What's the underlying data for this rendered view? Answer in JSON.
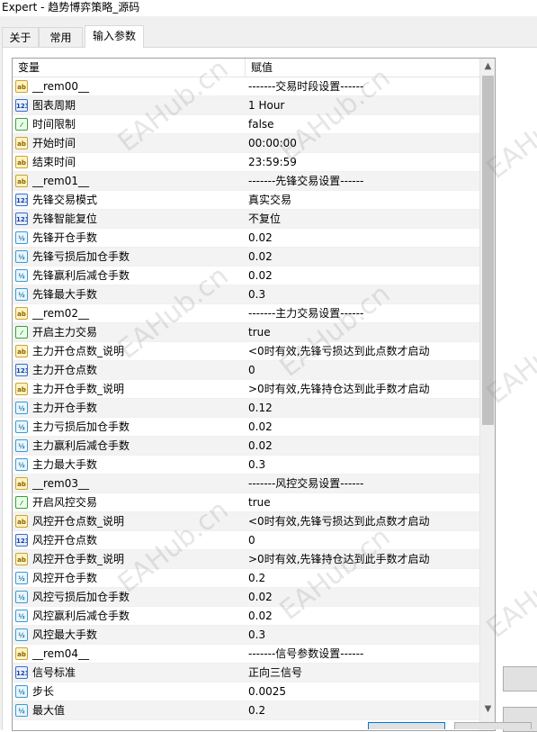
{
  "window": {
    "title": "Expert - 趋势博弈策略_源码"
  },
  "tabs": [
    {
      "label": "关于"
    },
    {
      "label": "常用"
    },
    {
      "label": "输入参数"
    }
  ],
  "grid": {
    "headers": {
      "variable": "变量",
      "value": "赋值"
    },
    "rows": [
      {
        "icon": "ab",
        "name": "__rem00__",
        "value": "-------交易时段设置------"
      },
      {
        "icon": "123",
        "name": "图表周期",
        "value": "1 Hour"
      },
      {
        "icon": "bool",
        "name": "时间限制",
        "value": "false"
      },
      {
        "icon": "ab",
        "name": "开始时间",
        "value": "00:00:00"
      },
      {
        "icon": "ab",
        "name": "结束时间",
        "value": "23:59:59"
      },
      {
        "icon": "ab",
        "name": "__rem01__",
        "value": "-------先锋交易设置------"
      },
      {
        "icon": "123",
        "name": "先锋交易模式",
        "value": "真实交易"
      },
      {
        "icon": "123",
        "name": "先锋智能复位",
        "value": "不复位"
      },
      {
        "icon": "v2",
        "name": "先锋开仓手数",
        "value": "0.02"
      },
      {
        "icon": "v2",
        "name": "先锋亏损后加仓手数",
        "value": "0.02"
      },
      {
        "icon": "v2",
        "name": "先锋赢利后减仓手数",
        "value": "0.02"
      },
      {
        "icon": "v2",
        "name": "先锋最大手数",
        "value": "0.3"
      },
      {
        "icon": "ab",
        "name": "__rem02__",
        "value": "-------主力交易设置------"
      },
      {
        "icon": "bool",
        "name": "开启主力交易",
        "value": "true"
      },
      {
        "icon": "ab",
        "name": "主力开仓点数_说明",
        "value": "<0时有效,先锋亏损达到此点数才启动"
      },
      {
        "icon": "123",
        "name": "主力开仓点数",
        "value": "0"
      },
      {
        "icon": "ab",
        "name": "主力开仓手数_说明",
        "value": ">0时有效,先锋持仓达到此手数才启动"
      },
      {
        "icon": "v2",
        "name": "主力开仓手数",
        "value": "0.12"
      },
      {
        "icon": "v2",
        "name": "主力亏损后加仓手数",
        "value": "0.02"
      },
      {
        "icon": "v2",
        "name": "主力赢利后减仓手数",
        "value": "0.02"
      },
      {
        "icon": "v2",
        "name": "主力最大手数",
        "value": "0.3"
      },
      {
        "icon": "ab",
        "name": "__rem03__",
        "value": "-------风控交易设置------"
      },
      {
        "icon": "bool",
        "name": "开启风控交易",
        "value": "true"
      },
      {
        "icon": "ab",
        "name": "风控开仓点数_说明",
        "value": "<0时有效,先锋亏损达到此点数才启动"
      },
      {
        "icon": "123",
        "name": "风控开仓点数",
        "value": "0"
      },
      {
        "icon": "ab",
        "name": "风控开仓手数_说明",
        "value": ">0时有效,先锋持仓达到此手数才启动"
      },
      {
        "icon": "v2",
        "name": "风控开仓手数",
        "value": "0.2"
      },
      {
        "icon": "v2",
        "name": "风控亏损后加仓手数",
        "value": "0.02"
      },
      {
        "icon": "v2",
        "name": "风控赢利后减仓手数",
        "value": "0.02"
      },
      {
        "icon": "v2",
        "name": "风控最大手数",
        "value": "0.3"
      },
      {
        "icon": "ab",
        "name": "__rem04__",
        "value": "-------信号参数设置------"
      },
      {
        "icon": "123",
        "name": "信号标准",
        "value": "正向三信号"
      },
      {
        "icon": "v2",
        "name": "步长",
        "value": "0.0025"
      },
      {
        "icon": "v2",
        "name": "最大值",
        "value": "0.2"
      }
    ]
  },
  "icons": {
    "ab": {
      "glyph": "ab",
      "name": "string-type-icon"
    },
    "123": {
      "glyph": "123",
      "name": "integer-type-icon"
    },
    "bool": {
      "glyph": "⁄",
      "name": "boolean-type-icon"
    },
    "v2": {
      "glyph": "½",
      "name": "double-type-icon"
    }
  },
  "watermark": "EAHub.cn",
  "scrollbar": {
    "up": "▲",
    "down": "▼"
  }
}
